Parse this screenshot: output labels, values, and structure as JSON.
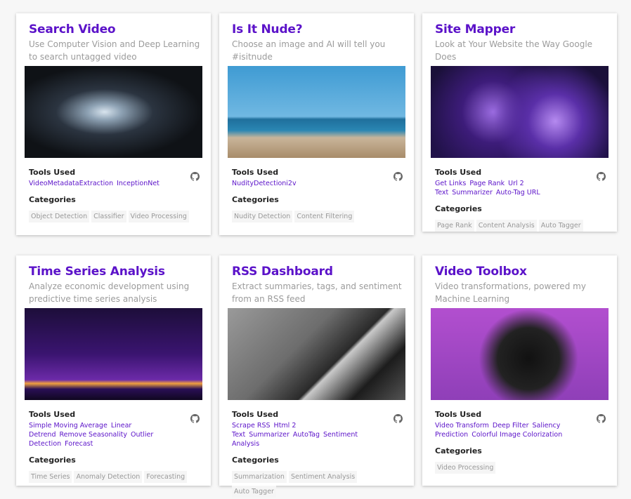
{
  "headings": {
    "tools": "Tools Used",
    "categories": "Categories"
  },
  "accent": "#5b12c9",
  "cards": [
    {
      "title": "Search Video",
      "subtitle": "Use Computer Vision and Deep Learning to search untagged video",
      "image": "phone-filming-concert",
      "tools": [
        "VideoMetadataExtraction",
        "InceptionNet"
      ],
      "categories": [
        "Object Detection",
        "Classifier",
        "Video Processing"
      ]
    },
    {
      "title": "Is It Nude?",
      "subtitle": "Choose an image and AI will tell you #isitnude",
      "image": "crowded-beach",
      "tools": [
        "NudityDetectioni2v"
      ],
      "categories": [
        "Nudity Detection",
        "Content Filtering"
      ]
    },
    {
      "title": "Site Mapper",
      "subtitle": "Look at Your Website the Way Google Does",
      "image": "usa-night-lights-map",
      "tools": [
        "Get Links",
        "Page Rank",
        "Url 2 Text",
        "Summarizer",
        "Auto-Tag URL"
      ],
      "categories": [
        "Page Rank",
        "Content Analysis",
        "Auto Tagger"
      ]
    },
    {
      "title": "Time Series Analysis",
      "subtitle": "Analyze economic development using predictive time series analysis",
      "image": "city-skyline-night",
      "tools": [
        "Simple Moving Average",
        "Linear Detrend",
        "Remove Seasonality",
        "Outlier Detection",
        "Forecast"
      ],
      "categories": [
        "Time Series",
        "Anomaly Detection",
        "Forecasting"
      ]
    },
    {
      "title": "RSS Dashboard",
      "subtitle": "Extract summaries, tags, and sentiment from an RSS feed",
      "image": "man-reading-newspaper",
      "tools": [
        "Scrape RSS",
        "Html 2 Text",
        "Summarizer",
        "AutoTag",
        "Sentiment Analysis"
      ],
      "categories": [
        "Summarization",
        "Sentiment Analysis",
        "Auto Tagger"
      ]
    },
    {
      "title": "Video Toolbox",
      "subtitle": "Video transformations, powered my Machine Learning",
      "image": "video-camera-purple",
      "tools": [
        "Video Transform",
        "Deep Filter",
        "Saliency Prediction",
        "Colorful Image Colorization"
      ],
      "categories": [
        "Video Processing"
      ]
    }
  ]
}
